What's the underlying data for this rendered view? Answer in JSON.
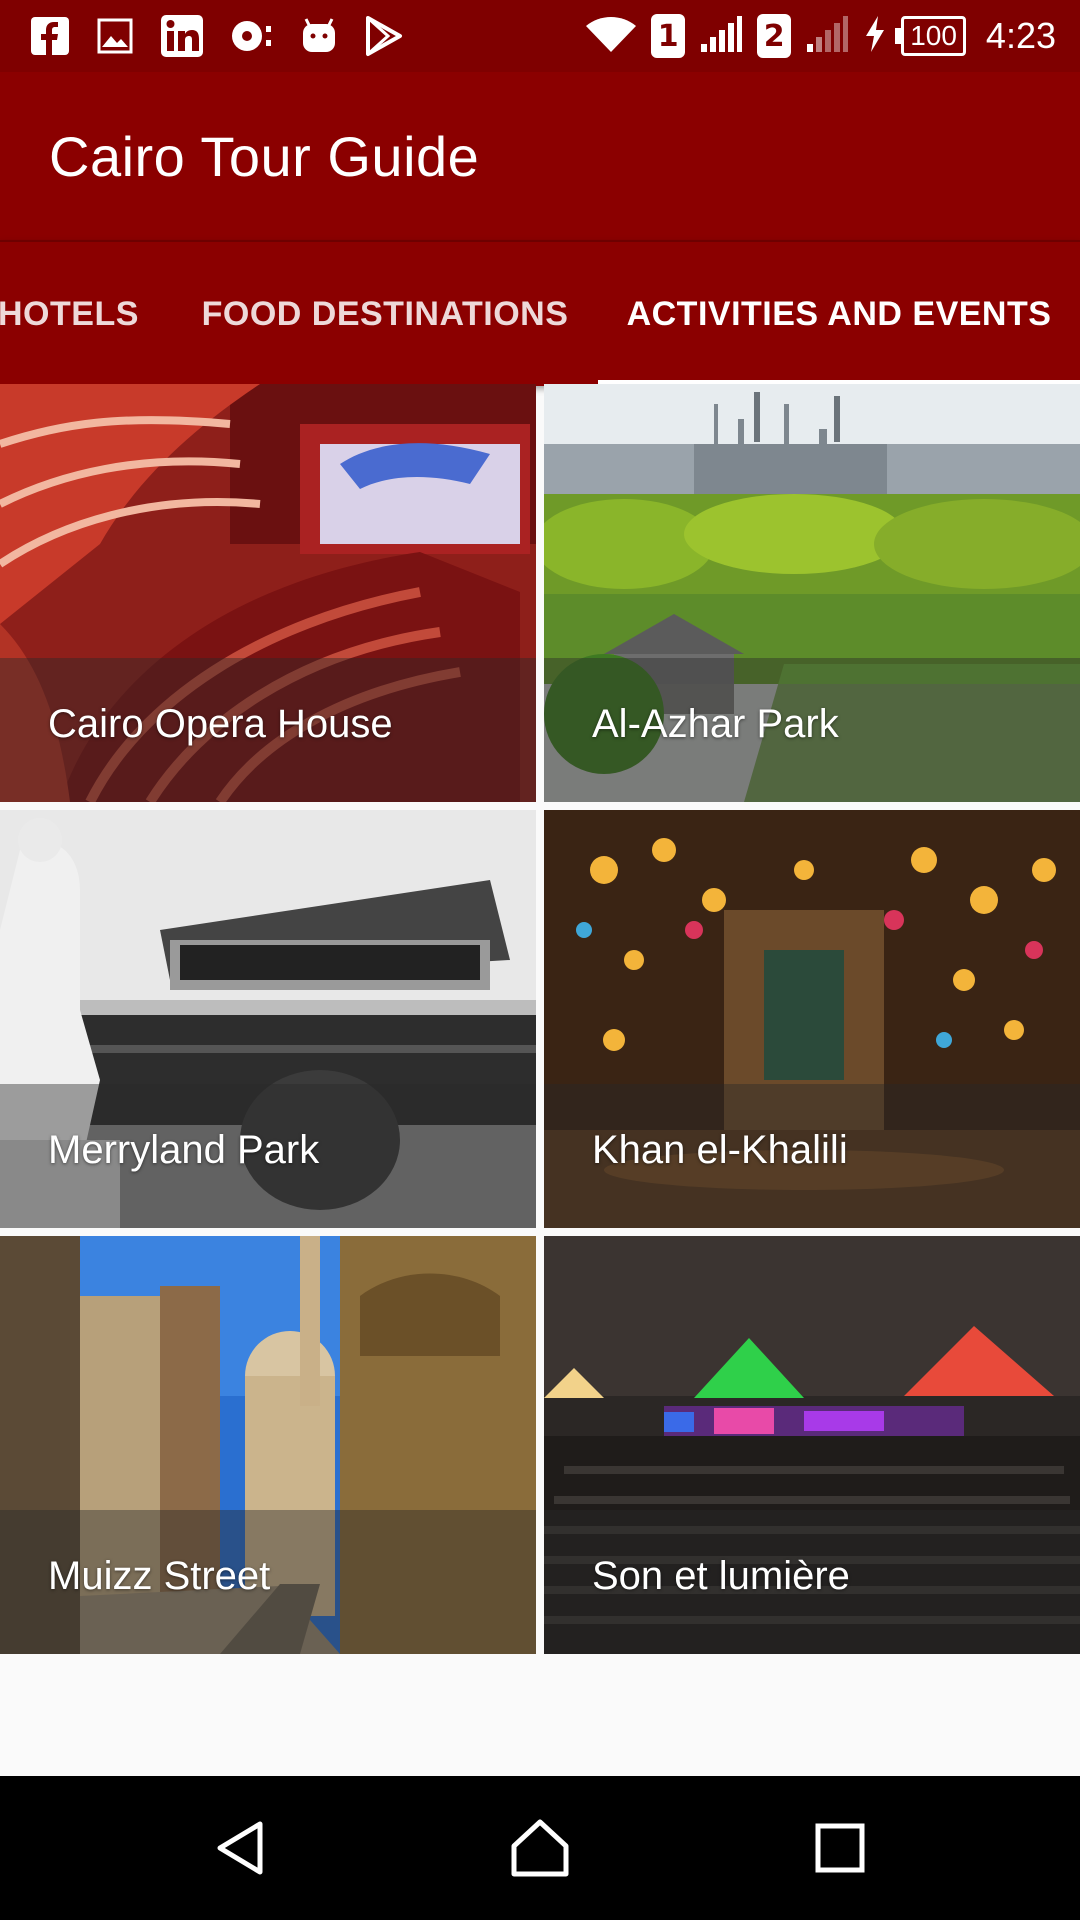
{
  "status_bar": {
    "sim1": "1",
    "sim2": "2",
    "battery": "100",
    "time": "4:23",
    "icons": [
      "facebook-icon",
      "image-icon",
      "linkedin-icon",
      "record-icon",
      "android-icon",
      "play-store-icon",
      "wifi-icon",
      "signal-icon",
      "charging-icon",
      "battery-icon"
    ]
  },
  "app_bar": {
    "title": "Cairo Tour Guide"
  },
  "tabs": [
    {
      "label": "HOTELS",
      "selected": false
    },
    {
      "label": "FOOD DESTINATIONS",
      "selected": false
    },
    {
      "label": "ACTIVITIES AND EVENTS",
      "selected": true
    }
  ],
  "places": [
    {
      "name": "Cairo Opera House"
    },
    {
      "name": "Al-Azhar Park"
    },
    {
      "name": "Merryland Park"
    },
    {
      "name": "Khan el-Khalili"
    },
    {
      "name": "Muizz Street"
    },
    {
      "name": "Son et lumière"
    }
  ],
  "colors": {
    "primary": "#8b0000",
    "primary_dark": "#7f0000",
    "nav_bar": "#000000",
    "background": "#fafafa"
  },
  "nav": {
    "buttons": [
      "back-icon",
      "home-icon",
      "recents-icon"
    ]
  }
}
